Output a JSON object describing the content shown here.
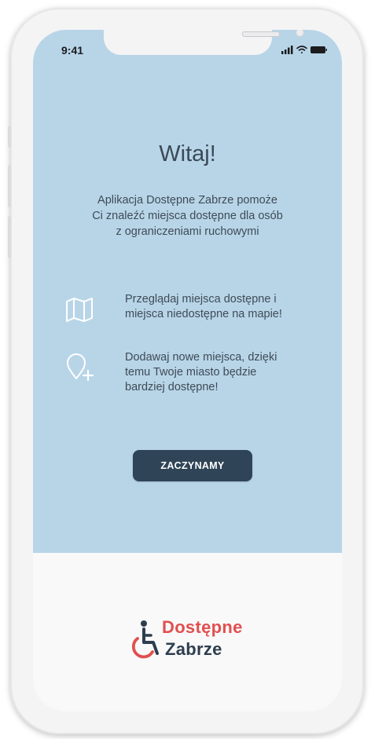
{
  "status_bar": {
    "time": "9:41"
  },
  "welcome": {
    "title": "Witaj!",
    "intro_lines": [
      "Aplikacja Dostępne Zabrze pomoże",
      "Ci znaleźć miejsca dostępne dla osób",
      "z ograniczeniami ruchowymi"
    ]
  },
  "features": [
    {
      "icon": "map-icon",
      "lines": [
        "Przeglądaj miejsca dostępne i",
        "miejsca niedostępne na mapie!"
      ]
    },
    {
      "icon": "add-location-icon",
      "lines": [
        "Dodawaj nowe miejsca, dzięki",
        "temu Twoje miasto będzie",
        "bardziej dostępne!"
      ]
    }
  ],
  "actions": {
    "start_label": "ZACZYNAMY"
  },
  "logo": {
    "icon": "wheelchair-icon",
    "word1": "Dostępne",
    "word2": "Zabrze"
  },
  "colors": {
    "screen_background": "#b8d5e8",
    "button": "#2f4557",
    "logo_accent": "#e0504e",
    "logo_dark": "#2d3e4e",
    "text": "#3f4b56"
  }
}
